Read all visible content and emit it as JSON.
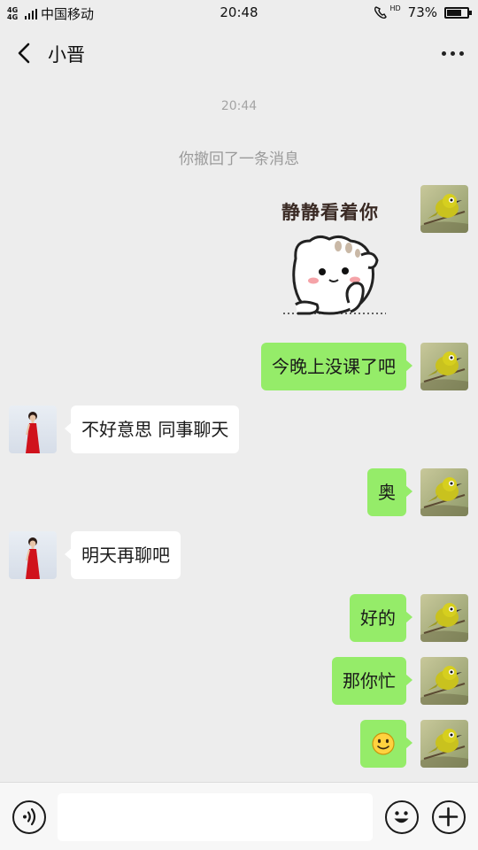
{
  "status_bar": {
    "network_type": "4G 4G",
    "carrier": "中国移动",
    "time": "20:48",
    "hd_label": "HD",
    "battery_percent": "73%",
    "battery_level": 0.73
  },
  "header": {
    "title": "小晋",
    "back_icon": "chevron-left-icon",
    "more_icon": "more-dots-icon"
  },
  "chat": {
    "timestamp": "20:44",
    "system_message": "你撤回了一条消息",
    "sticker_text": "静静看着你",
    "messages": [
      {
        "sender": "me",
        "type": "sticker"
      },
      {
        "sender": "me",
        "text": "今晚上没课了吧"
      },
      {
        "sender": "other",
        "text": "不好意思 同事聊天"
      },
      {
        "sender": "me",
        "text": "奥"
      },
      {
        "sender": "other",
        "text": "明天再聊吧"
      },
      {
        "sender": "me",
        "text": "好的"
      },
      {
        "sender": "me",
        "text": "那你忙"
      },
      {
        "sender": "me",
        "type": "emoji",
        "emoji": "smile-emoji"
      }
    ]
  },
  "input_bar": {
    "voice_icon": "voice-icon",
    "input_value": "",
    "emoji_icon": "emoji-icon",
    "plus_icon": "plus-icon"
  },
  "colors": {
    "background": "#ededed",
    "my_bubble": "#95ec69",
    "their_bubble": "#ffffff"
  }
}
